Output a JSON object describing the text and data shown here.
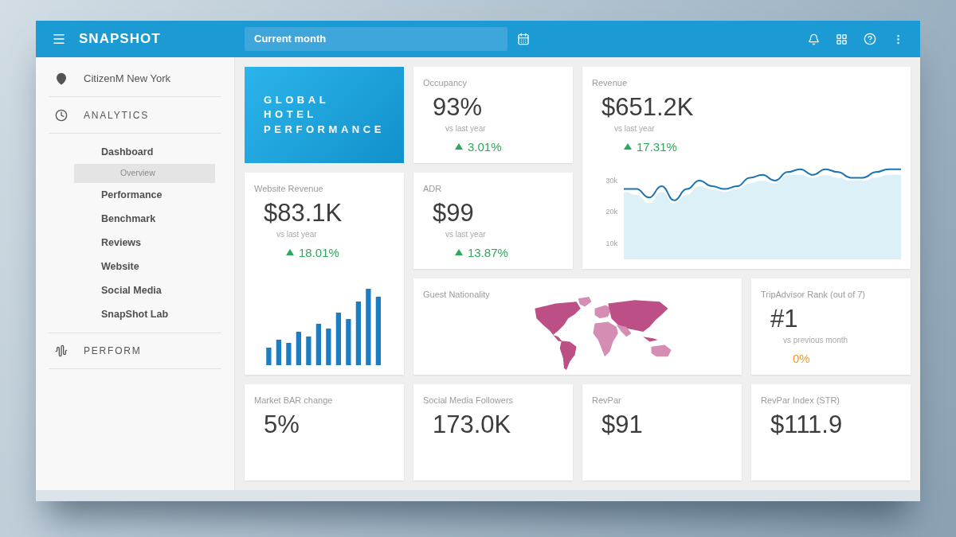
{
  "header": {
    "app_name": "SNAPSHOT",
    "period": {
      "value": "Current month"
    }
  },
  "sidebar": {
    "location": {
      "label": "CitizenM New York"
    },
    "analytics": {
      "label": "ANALYTICS",
      "items": [
        {
          "label": "Dashboard",
          "selected": false,
          "children": [
            {
              "label": "Overview",
              "selected": true
            }
          ]
        },
        {
          "label": "Performance",
          "selected": false
        },
        {
          "label": "Benchmark",
          "selected": false
        },
        {
          "label": "Reviews",
          "selected": false
        },
        {
          "label": "Website",
          "selected": false
        },
        {
          "label": "Social Media",
          "selected": false
        },
        {
          "label": "SnapShot Lab",
          "selected": false
        }
      ]
    },
    "perform": {
      "label": "PERFORM"
    }
  },
  "banner": {
    "title": "GLOBAL HOTEL PERFORMANCE"
  },
  "cards": [
    {
      "kind": "stat",
      "label": "Occupancy",
      "value": "93%",
      "comparison": "vs last year",
      "change": {
        "value": "3.01%",
        "up": true,
        "color": "#2ea85a"
      }
    },
    {
      "kind": "line_chart",
      "label": "Revenue",
      "value": "$651.2K",
      "comparison": "vs last year",
      "change": {
        "value": "17.31%",
        "up": true,
        "color": "#2ea85a"
      },
      "axis_labels": [
        "30k",
        "20k",
        "10k"
      ]
    },
    {
      "kind": "bar_chart",
      "label": "Website Revenue",
      "value": "$83.1K",
      "comparison": "vs last year",
      "change": {
        "value": "18.01%",
        "up": true,
        "color": "#2ea85a"
      }
    },
    {
      "kind": "stat",
      "label": "ADR",
      "value": "$99",
      "comparison": "vs last year",
      "change": {
        "value": "13.87%",
        "up": true,
        "color": "#2ea85a"
      }
    },
    {
      "kind": "map",
      "label": "Guest Nationality"
    },
    {
      "kind": "stat",
      "label": "TripAdvisor Rank (out of 7)",
      "value": "#1",
      "comparison": "vs previous month",
      "change": {
        "value": "0%",
        "up": false,
        "color": "#f39c2c"
      }
    },
    {
      "kind": "stat",
      "label": "Market BAR change",
      "value": "5%"
    },
    {
      "kind": "stat",
      "label": "Social Media Followers",
      "value": "173.0K"
    },
    {
      "kind": "stat",
      "label": "RevPar",
      "value": "$91"
    },
    {
      "kind": "stat",
      "label": "RevPar Index (STR)",
      "value": "$111.9"
    }
  ]
}
